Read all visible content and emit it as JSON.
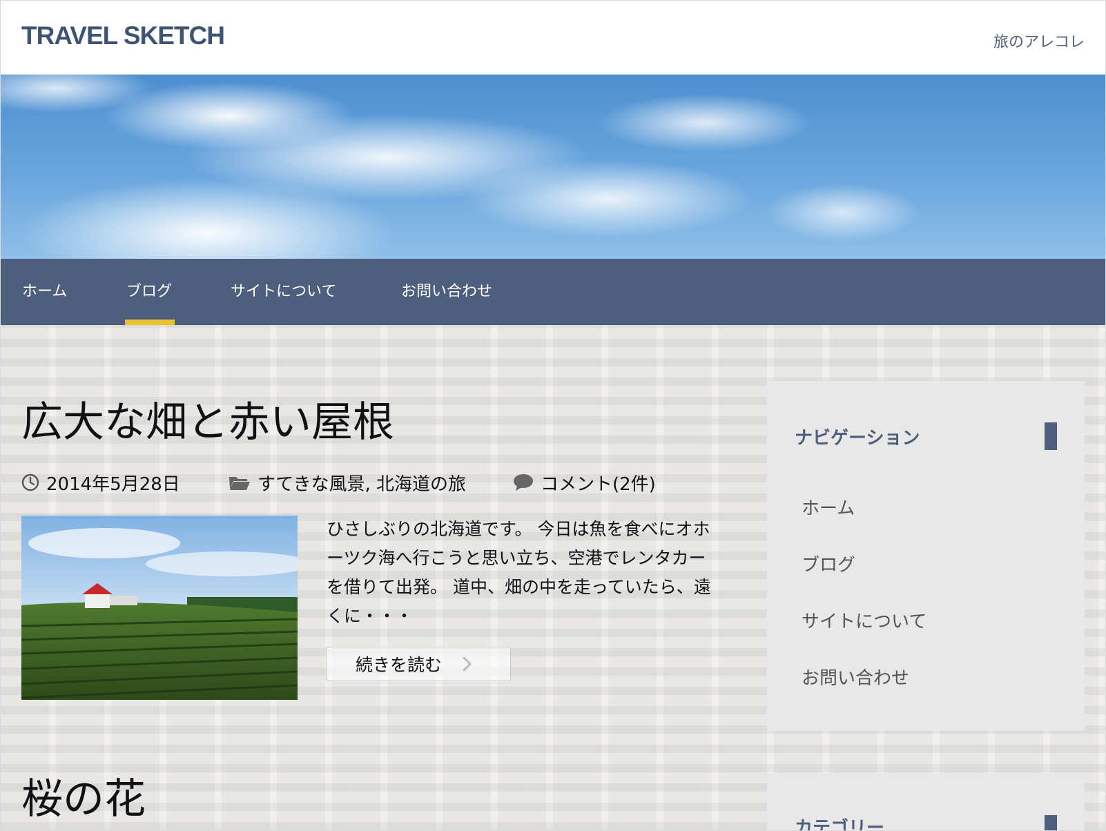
{
  "header": {
    "site_title": "TRAVEL SKETCH",
    "tagline": "旅のアレコレ"
  },
  "nav": {
    "items": [
      {
        "label": "ホーム"
      },
      {
        "label": "ブログ",
        "active": true
      },
      {
        "label": "サイトについて"
      },
      {
        "label": "お問い合わせ"
      }
    ],
    "active_indicator_color": "#e7c12f",
    "background_color": "#4e5f7d"
  },
  "posts": [
    {
      "title": "広大な畑と赤い屋根",
      "date": "2014年5月28日",
      "categories": "すてきな風景, 北海道の旅",
      "comments": "コメント(2件)",
      "excerpt": "ひさしぶりの北海道です。 今日は魚を食べにオホーツク海へ行こうと思い立ち、空港でレンタカーを借りて出発。 道中、畑の中を走っていたら、遠くに・・・",
      "read_more": "続きを読む",
      "icons": {
        "date": "clock-icon",
        "category": "folder-icon",
        "comments": "comment-icon",
        "read_more": "chevron-right-icon"
      }
    },
    {
      "title": "桜の花"
    }
  ],
  "sidebar": {
    "navigation": {
      "title": "ナビゲーション",
      "links": [
        "ホーム",
        "ブログ",
        "サイトについて",
        "お問い合わせ"
      ]
    },
    "category": {
      "title": "カテゴリー"
    }
  }
}
